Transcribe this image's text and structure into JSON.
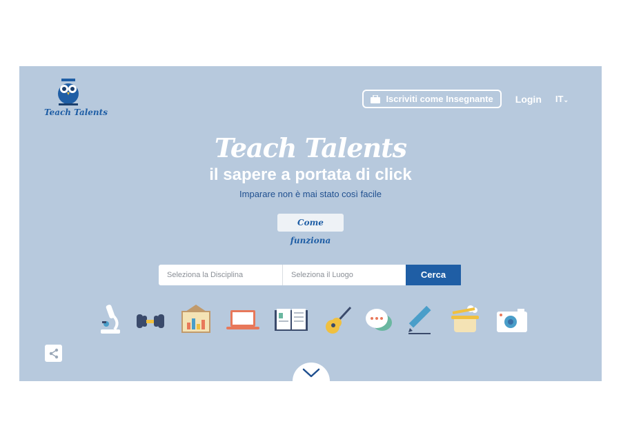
{
  "header": {
    "logo_text": "Teach Talents",
    "teacher_button": "Iscriviti come Insegnante",
    "login": "Login",
    "language": "IT"
  },
  "hero": {
    "brand": "Teach Talents",
    "headline": "il sapere a portata di click",
    "subline": "Imparare non è mai stato così facile",
    "how_button": "Come funziona"
  },
  "search": {
    "discipline_placeholder": "Seleziona la Disciplina",
    "location_placeholder": "Seleziona il Luogo",
    "button": "Cerca"
  },
  "categories": [
    {
      "icon": "microscope-icon"
    },
    {
      "icon": "dumbbell-icon"
    },
    {
      "icon": "chart-board-icon"
    },
    {
      "icon": "laptop-icon"
    },
    {
      "icon": "book-icon"
    },
    {
      "icon": "guitar-icon"
    },
    {
      "icon": "speech-bubbles-icon"
    },
    {
      "icon": "pencil-icon"
    },
    {
      "icon": "cooking-pot-icon"
    },
    {
      "icon": "camera-icon"
    }
  ],
  "colors": {
    "hero_background": "#b7c9dd",
    "brand_blue": "#1f5ea5",
    "text_white": "#ffffff"
  }
}
